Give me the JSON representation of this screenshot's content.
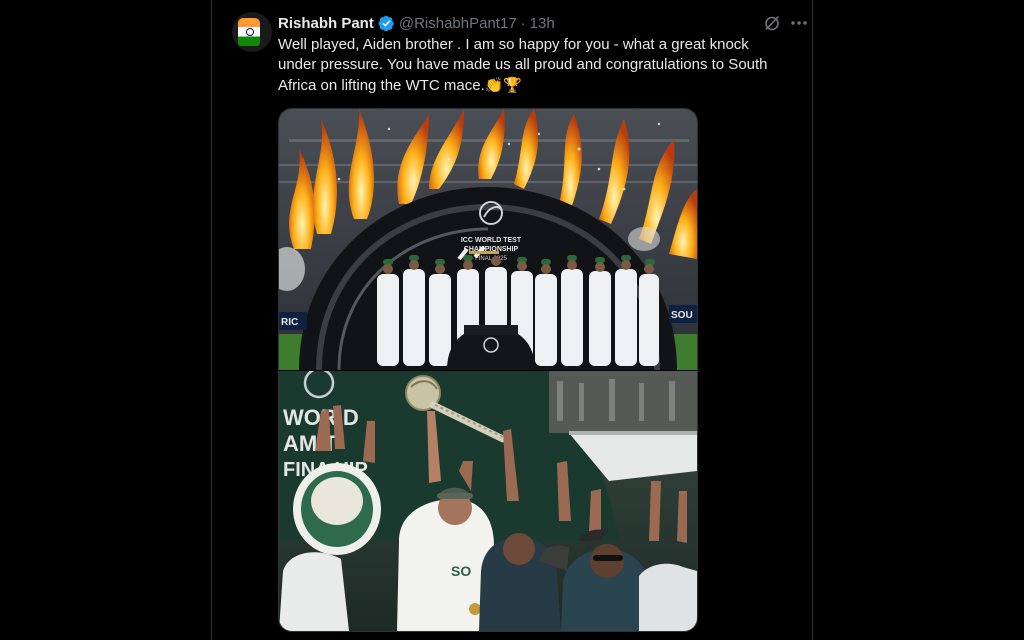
{
  "tweet": {
    "author_name": "Rishabh Pant",
    "handle": "@RishabhPant17",
    "separator": "·",
    "time": "13h",
    "text_line1": "Well played, Aiden brother . I am so happy for you - what a great knock",
    "text_line2": "under pressure. You have made us all proud and congratulations to South",
    "text_line3": "Africa on lifting the WTC mace.",
    "emojis": "👏🏆"
  },
  "media": {
    "top_photo": {
      "board_line1": "ICC WORLD TEST",
      "board_line2": "CHAMPIONSHIP",
      "board_line3": "FINAL 2025",
      "left_edge": "RIC",
      "right_edge": "SOU"
    },
    "bottom_photo": {
      "board_line1": "WOR D",
      "board_line2": "AM  T",
      "board_line3": "FINA  HIP",
      "shirt": "SO"
    }
  },
  "icons": {
    "avatar": "india-flag-avatar",
    "verified": "verified-badge-icon",
    "grok": "grok-icon",
    "more": "more-icon"
  },
  "colors": {
    "background": "#000000",
    "text": "#e7e9ea",
    "secondary": "#71767b",
    "verified": "#1d9bf0",
    "border": "#2f3336"
  }
}
